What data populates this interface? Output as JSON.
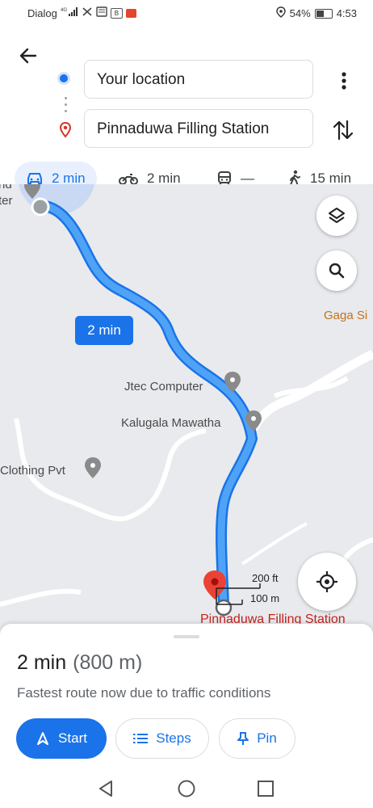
{
  "status_bar": {
    "carrier": "Dialog",
    "network": "4G",
    "battery": "54%",
    "battery_level": 0.54,
    "time": "4:53"
  },
  "directions": {
    "origin_value": "Your location",
    "destination_value": "Pinnaduwa Filling Station",
    "modes": [
      {
        "name": "drive",
        "icon": "car-icon",
        "label": "2 min",
        "active": true
      },
      {
        "name": "motorcycle",
        "icon": "motorcycle-icon",
        "label": "2 min",
        "active": false
      },
      {
        "name": "transit",
        "icon": "train-icon",
        "label": "—",
        "active": false
      },
      {
        "name": "walk",
        "icon": "walk-icon",
        "label": "15 min",
        "active": false
      }
    ]
  },
  "map": {
    "route_time_badge": "2 min",
    "labels": {
      "top_left_1": "nd",
      "top_left_2": "ter",
      "gaga": "Gaga Si",
      "jtec": "Jtec Computer",
      "kalugala": "Kalugala Mawatha",
      "clothing": "Clothing Pvt",
      "destination": "Pinnaduwa Filling Station"
    },
    "scale": {
      "imperial": "200 ft",
      "metric": "100 m"
    },
    "colors": {
      "route": "#4285f4",
      "route_outline": "#1a73e8",
      "pin": "#ea4335",
      "place_icon": "#8a8a8a"
    }
  },
  "sheet": {
    "eta": "2 min",
    "distance": "(800 m)",
    "reason": "Fastest route now due to traffic conditions",
    "buttons": {
      "start": "Start",
      "steps": "Steps",
      "pin": "Pin"
    }
  }
}
